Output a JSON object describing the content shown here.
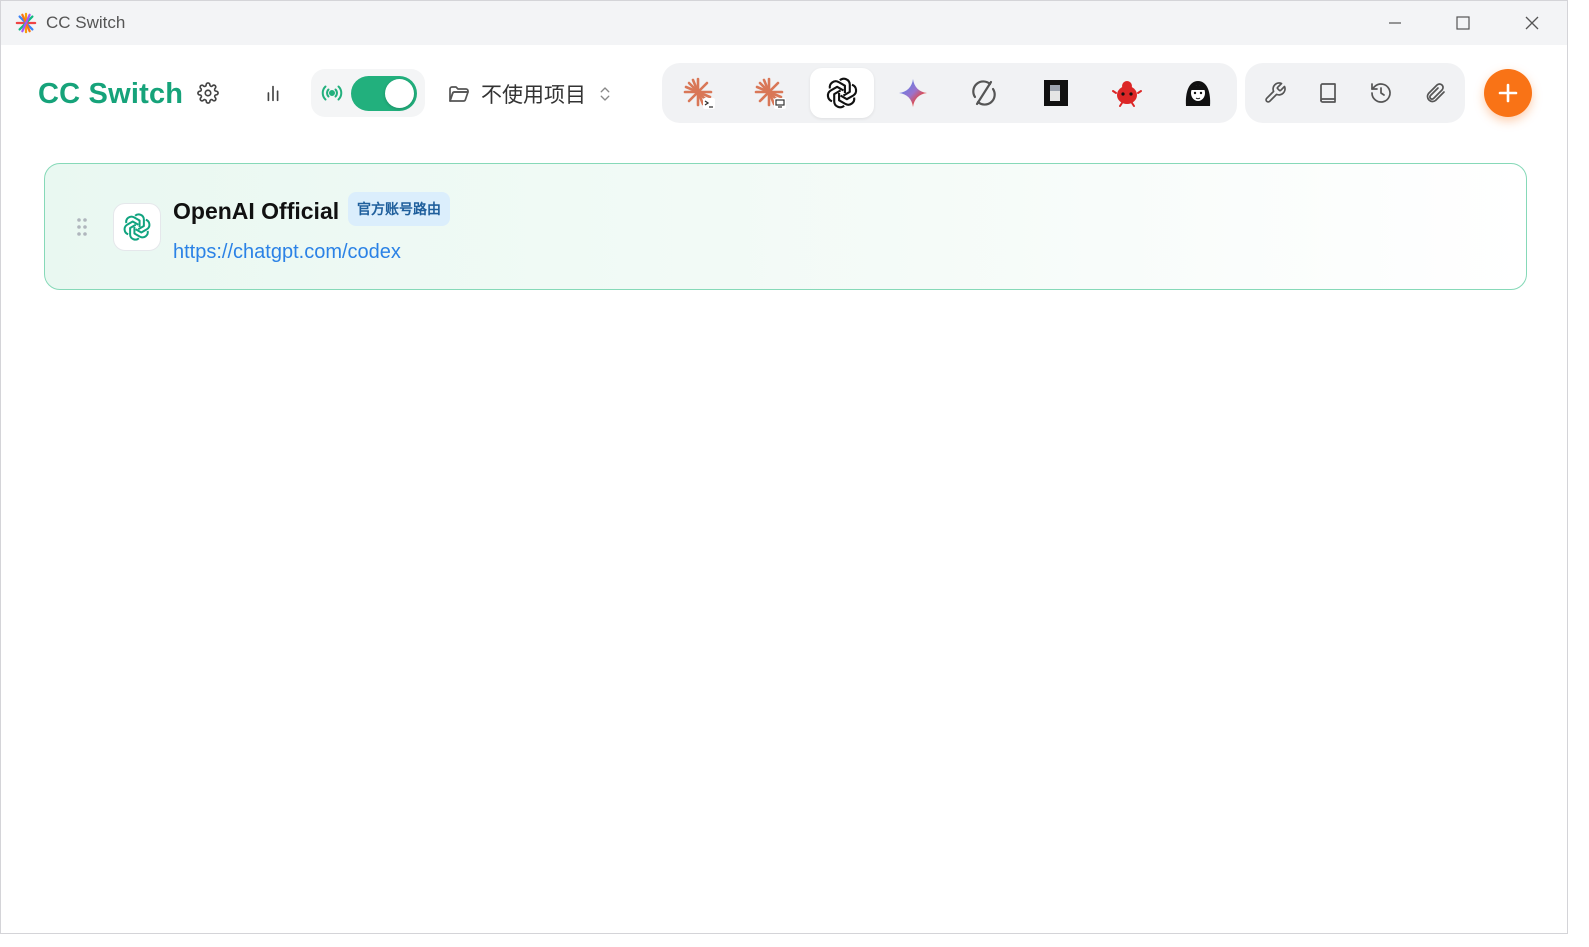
{
  "window": {
    "title": "CC Switch"
  },
  "header": {
    "brand": "CC Switch",
    "proxy_enabled": true,
    "project_label": "不使用项目"
  },
  "app_tabs": [
    {
      "name": "claude-code",
      "icon": "claude-terminal-icon",
      "active": false
    },
    {
      "name": "claude-desktop",
      "icon": "claude-desktop-icon",
      "active": false
    },
    {
      "name": "openai-codex",
      "icon": "openai-icon",
      "active": true
    },
    {
      "name": "gemini",
      "icon": "gemini-icon",
      "active": false
    },
    {
      "name": "opencode",
      "icon": "circle-slash-icon",
      "active": false
    },
    {
      "name": "app-6",
      "icon": "black-square-icon",
      "active": false
    },
    {
      "name": "app-7",
      "icon": "red-bug-icon",
      "active": false
    },
    {
      "name": "app-8",
      "icon": "avatar-girl-icon",
      "active": false
    }
  ],
  "tools": [
    {
      "name": "wrench",
      "icon": "wrench-icon"
    },
    {
      "name": "book",
      "icon": "book-icon"
    },
    {
      "name": "history",
      "icon": "history-icon"
    },
    {
      "name": "paperclip",
      "icon": "paperclip-icon"
    }
  ],
  "providers": [
    {
      "name": "OpenAI Official",
      "badge": "官方账号路由",
      "url": "https://chatgpt.com/codex",
      "icon": "openai-icon"
    }
  ],
  "colors": {
    "brand": "#16a37a",
    "toggle_on": "#22b07d",
    "add_button": "#f97316",
    "card_border": "#86d9b8",
    "link": "#2b82e6"
  }
}
